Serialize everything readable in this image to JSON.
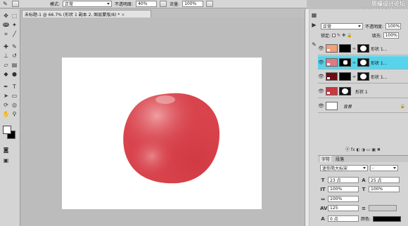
{
  "options_bar": {
    "mode_label": "模式:",
    "mode_value": "正常",
    "opacity_label": "不透明度:",
    "opacity_value": "40%",
    "flow_label": "流量:",
    "flow_value": "100%"
  },
  "watermark": {
    "line1": "思缘设计论坛",
    "line2": "WWW.MISSYUAN.COM"
  },
  "document": {
    "tab_title": "未标题-1 @ 66.7% (形状 1 副本 2, 图层蒙版/8) *",
    "close_glyph": "×"
  },
  "colors": {
    "apple_base": "#d8434c",
    "apple_highlight": "#ea8a90",
    "layer_selected": "#57d4ec",
    "swatch_peach": "#f0a07a",
    "swatch_pink": "#e07a82",
    "swatch_darkred": "#6b0d14",
    "swatch_red": "#c9373f"
  },
  "layers_panel": {
    "blend_mode": "正常",
    "opacity_label": "不透明度:",
    "opacity_value": "100%",
    "lock_label": "锁定:",
    "fill_label": "填充:",
    "fill_value": "100%",
    "layers": [
      {
        "name": "形状 1...",
        "swatch": "peach",
        "selected": false
      },
      {
        "name": "形状 1...",
        "swatch": "pink",
        "selected": true
      },
      {
        "name": "形状 1...",
        "swatch": "darkred",
        "selected": false
      },
      {
        "name": "形状 1",
        "swatch": "red",
        "selected": false
      },
      {
        "name": "背景",
        "swatch": "white",
        "selected": false
      }
    ],
    "bottom_icons": "ⓔ fx ◐ ◑ ▭ ▣ ✖"
  },
  "character_panel": {
    "tab_character": "字符",
    "tab_paragraph": "段落",
    "font_family": "迷你简大标宋",
    "font_style": "-",
    "size_value": "23 点",
    "leading_value": "25 点",
    "vscale_value": "100%",
    "hscale_value": "100%",
    "tracking_value": "100%",
    "kerning_value": "125",
    "baseline_value": "0 点",
    "color_label": "颜色:"
  }
}
